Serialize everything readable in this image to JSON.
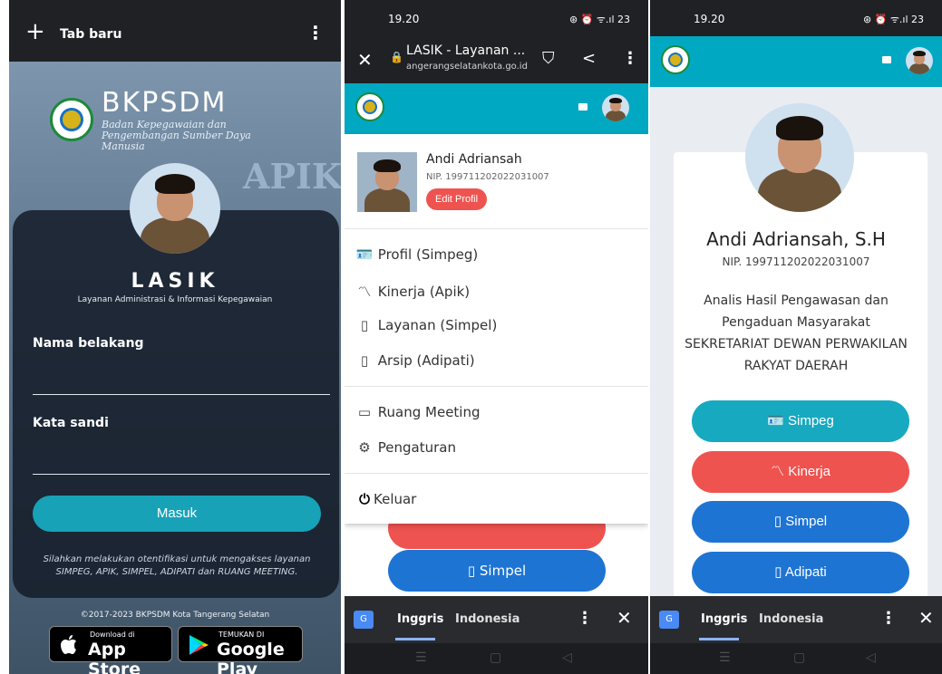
{
  "panel1": {
    "new_tab_label": "Tab baru",
    "bkpsdm_title": "BKPSDM",
    "bkpsdm_sub": "Badan Kepegawaian dan Pengembangan Sumber Daya Manusia",
    "apik_bg": "APIK",
    "app_title": "LASIK",
    "app_subtitle": "Layanan Administrasi & Informasi Kepegawaian",
    "field1_label": "Nama belakang",
    "field1_value": "",
    "field2_label": "Kata sandi",
    "field2_value": "",
    "login_button": "Masuk",
    "note": "Silahkan melakukan otentifikasi untuk mengakses layanan SIMPEG, APIK, SIMPEL, ADIPATI dan RUANG MEETING.",
    "copyright": "©2017-2023 BKPSDM Kota Tangerang Selatan",
    "appstore_small": "Download di",
    "appstore_big": "App Store",
    "play_small": "TEMUKAN DI",
    "play_big": "Google Play"
  },
  "panel2": {
    "time": "19.20",
    "status_right": "⊛ ⏰ ᯤ.ıl 23",
    "page_title": "LASIK - Layanan ...",
    "domain": "angerangselatankota.go.id",
    "profile_name": "Andi Adriansah",
    "profile_nip": "NIP. 199711202022031007",
    "edit_button": "Edit Profil",
    "menu": [
      {
        "icon": "id-card-icon",
        "glyph": "🪪",
        "label": "Profil (Simpeg)"
      },
      {
        "icon": "chart-line-icon",
        "glyph": "〽",
        "label": "Kinerja (Apik)"
      },
      {
        "icon": "book-icon",
        "glyph": "▯",
        "label": "Layanan (Simpel)"
      },
      {
        "icon": "book-icon",
        "glyph": "▯",
        "label": "Arsip (Adipati)"
      },
      {
        "icon": "monitor-icon",
        "glyph": "▭",
        "label": "Ruang Meeting"
      },
      {
        "icon": "gear-icon",
        "glyph": "⚙",
        "label": "Pengaturan"
      },
      {
        "icon": "power-icon",
        "glyph": "⏻",
        "label": "Keluar"
      }
    ],
    "behind_button": "Simpel",
    "lang_en": "Inggris",
    "lang_id": "Indonesia"
  },
  "panel3": {
    "time": "19.20",
    "status_right": "⊛ ⏰ ᯤ.ıl 23",
    "name": "Andi Adriansah, S.H",
    "nip": "NIP. 199711202022031007",
    "job": "Analis Hasil Pengawasan dan Pengaduan Masyarakat",
    "unit": "SEKRETARIAT DEWAN PERWAKILAN RAKYAT DAERAH",
    "buttons": [
      {
        "label": "Simpeg",
        "icon": "id-card-icon",
        "color": "#17a9bf"
      },
      {
        "label": "Kinerja",
        "icon": "chart-line-icon",
        "color": "#ef5350"
      },
      {
        "label": "Simpel",
        "icon": "book-icon",
        "color": "#1e74d2"
      },
      {
        "label": "Adipati",
        "icon": "book-icon",
        "color": "#1e74d2"
      }
    ],
    "lang_en": "Inggris",
    "lang_id": "Indonesia"
  },
  "colors": {
    "teal": "#00a8c2",
    "red": "#ef5350",
    "blue": "#1e74d2",
    "dark": "#202124"
  }
}
